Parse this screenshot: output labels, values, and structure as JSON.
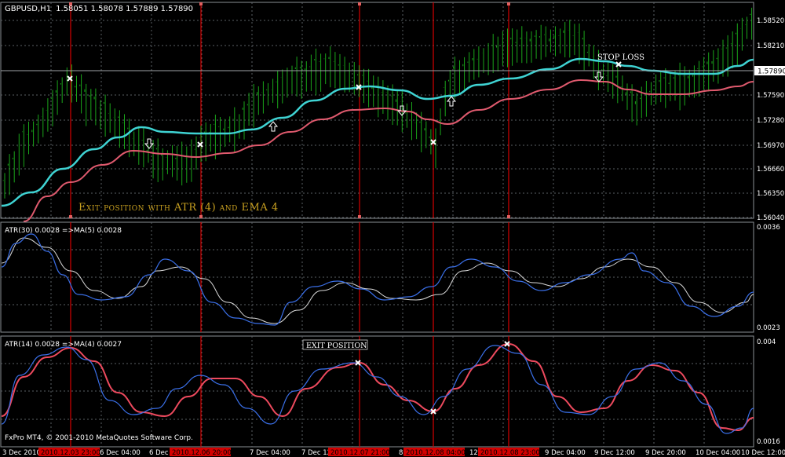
{
  "header": {
    "symbol": "GBPUSD,H1",
    "ohlc": "1.58051 1.58078 1.57889 1.57890"
  },
  "price_panel": {
    "axis_labels": [
      "1.58520",
      "1.58210",
      "1.57890",
      "1.57590",
      "1.57280",
      "1.56970",
      "1.56660",
      "1.56350",
      "1.56040"
    ],
    "current_price": "1.57890",
    "exit_text": "Exit position with ATR (4) and EMA 4",
    "stop_loss_label": "STOP LOSS"
  },
  "atr30_panel": {
    "title": "ATR(30) 0.0028  =>MA(5) 0.0028",
    "axis_top": "0.0036",
    "axis_bottom": "0.0023"
  },
  "atr14_panel": {
    "title": "ATR(14) 0.0028  =>MA(4) 0.0027",
    "axis_top": "0.004",
    "axis_bottom": "0.0016",
    "exit_label": "EXIT POSITION"
  },
  "footer": {
    "copyright": "FxPro MT4, © 2001-2010 MetaQuotes Software Corp."
  },
  "time_axis": {
    "labels": [
      "3 Dec 2010",
      "6 Dec 04:00",
      "6 Dec",
      "7 Dec 04:00",
      "7 Dec 12:",
      "8",
      "12:",
      "9 Dec 04:00",
      "9 Dec 12:00",
      "9 Dec 20:00",
      "10 Dec 04:00",
      "10 Dec 12:00"
    ],
    "highlight_labels": [
      "2010.12.03 23:00",
      "2010.12.06 20:00",
      "2010.12.07 21:00",
      "2010.12.08 04:00",
      "2010.12.08 23:00"
    ]
  },
  "colors": {
    "background": "#000000",
    "grid": "#5a5f65",
    "bull_candle": "#1aa51a",
    "ema_fast": "#3fd3d3",
    "ema_slow": "#e05a6e",
    "atr_blue": "#3a6fe8",
    "atr_ma": "#d8d8d8",
    "atr_ma_red": "#ee4a5e",
    "vline": "#d40000",
    "exit_text": "#c8a020"
  }
}
